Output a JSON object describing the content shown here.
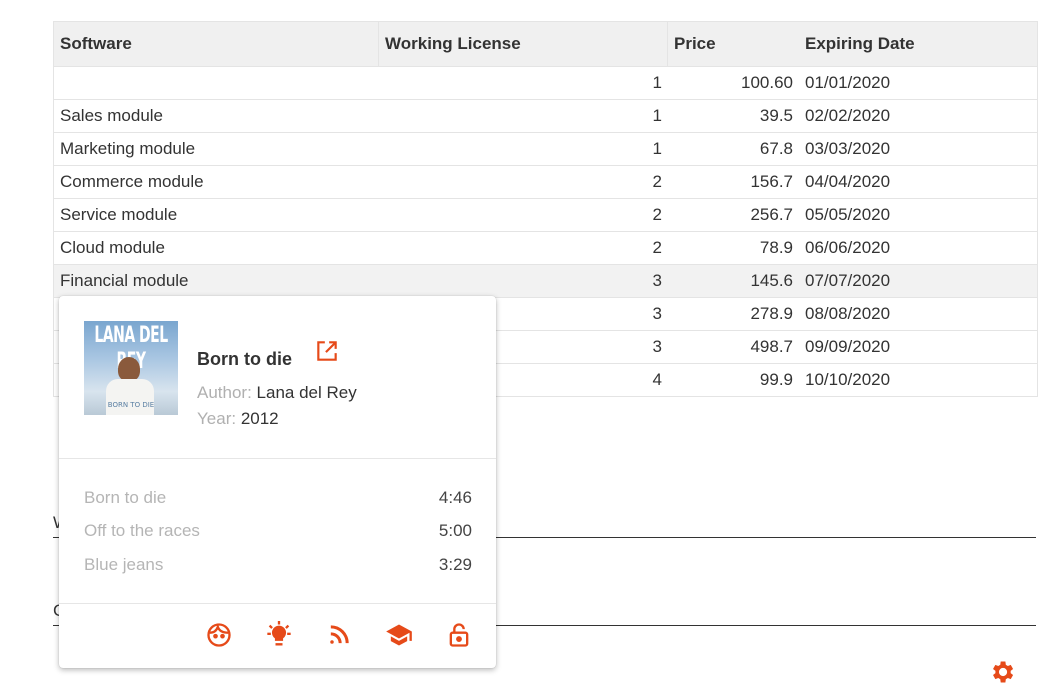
{
  "table": {
    "headers": [
      "Software",
      "Working License",
      "Price",
      "Expiring Date"
    ],
    "rows": [
      {
        "software": "",
        "license": "1",
        "price": "100.60",
        "date": "01/01/2020"
      },
      {
        "software": "Sales module",
        "license": "1",
        "price": "39.5",
        "date": "02/02/2020"
      },
      {
        "software": "Marketing module",
        "license": "1",
        "price": "67.8",
        "date": "03/03/2020"
      },
      {
        "software": "Commerce module",
        "license": "2",
        "price": "156.7",
        "date": "04/04/2020"
      },
      {
        "software": "Service module",
        "license": "2",
        "price": "256.7",
        "date": "05/05/2020"
      },
      {
        "software": "Cloud module",
        "license": "2",
        "price": "78.9",
        "date": "06/06/2020"
      },
      {
        "software": "Financial module",
        "license": "3",
        "price": "145.6",
        "date": "07/07/2020"
      },
      {
        "software": "",
        "license": "3",
        "price": "278.9",
        "date": "08/08/2020"
      },
      {
        "software": "",
        "license": "3",
        "price": "498.7",
        "date": "09/09/2020"
      },
      {
        "software": "",
        "license": "4",
        "price": "99.9",
        "date": "10/10/2020"
      }
    ]
  },
  "form": {
    "field1_label": "W",
    "field2_label": "C"
  },
  "card": {
    "cover_text": "LANA DEL REY",
    "cover_subtext": "BORN TO DIE",
    "title": "Born to die",
    "author_label": "Author:",
    "author_value": "Lana del Rey",
    "year_label": "Year:",
    "year_value": "2012",
    "tracks": [
      {
        "name": "Born to die",
        "duration": "4:46"
      },
      {
        "name": "Off to the races",
        "duration": "5:00"
      },
      {
        "name": "Blue jeans",
        "duration": "3:29"
      }
    ],
    "actions": [
      "face-icon",
      "lightbulb-icon",
      "rss-icon",
      "graduation-cap-icon",
      "lock-open-icon"
    ]
  },
  "colors": {
    "accent": "#e64a19",
    "header_bg": "#f0f0f0",
    "muted_text": "#b0b0b0"
  }
}
